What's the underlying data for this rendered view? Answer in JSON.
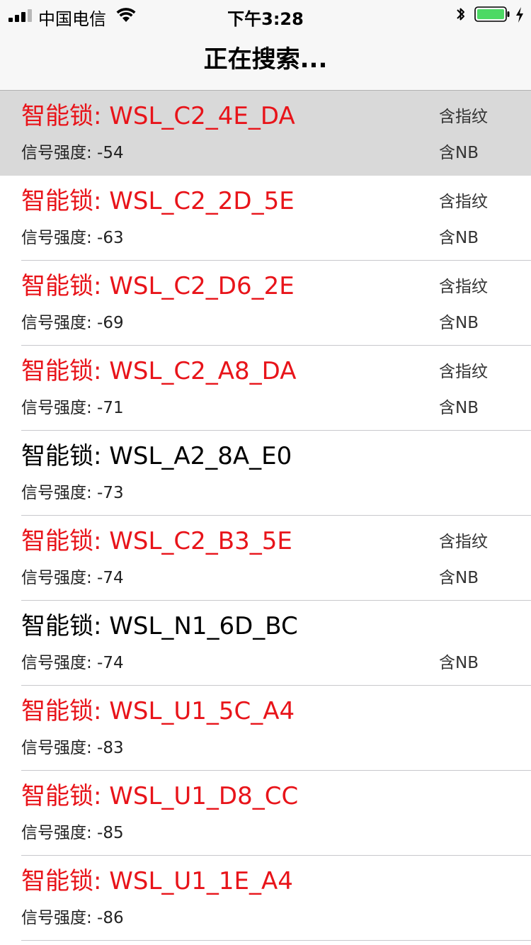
{
  "status_bar": {
    "carrier": "中国电信",
    "time": "下午3:28",
    "battery_color": "#4cd964"
  },
  "nav": {
    "title": "正在搜索..."
  },
  "colors": {
    "highlight_name": "#e8141a",
    "normal_name": "#000000",
    "selected_row_bg": "#d9d9d9"
  },
  "devices": [
    {
      "name": "智能锁: WSL_C2_4E_DA",
      "signal": "信号强度: -54",
      "fingerprint": "含指纹",
      "nb": "含NB",
      "highlight": true,
      "selected": true
    },
    {
      "name": "智能锁: WSL_C2_2D_5E",
      "signal": "信号强度: -63",
      "fingerprint": "含指纹",
      "nb": "含NB",
      "highlight": true,
      "selected": false
    },
    {
      "name": "智能锁: WSL_C2_D6_2E",
      "signal": "信号强度: -69",
      "fingerprint": "含指纹",
      "nb": "含NB",
      "highlight": true,
      "selected": false
    },
    {
      "name": "智能锁: WSL_C2_A8_DA",
      "signal": "信号强度: -71",
      "fingerprint": "含指纹",
      "nb": "含NB",
      "highlight": true,
      "selected": false
    },
    {
      "name": "智能锁: WSL_A2_8A_E0",
      "signal": "信号强度: -73",
      "fingerprint": "",
      "nb": "",
      "highlight": false,
      "selected": false
    },
    {
      "name": "智能锁: WSL_C2_B3_5E",
      "signal": "信号强度: -74",
      "fingerprint": "含指纹",
      "nb": "含NB",
      "highlight": true,
      "selected": false
    },
    {
      "name": "智能锁: WSL_N1_6D_BC",
      "signal": "信号强度: -74",
      "fingerprint": "",
      "nb": "含NB",
      "highlight": false,
      "selected": false
    },
    {
      "name": "智能锁: WSL_U1_5C_A4",
      "signal": "信号强度: -83",
      "fingerprint": "",
      "nb": "",
      "highlight": true,
      "selected": false
    },
    {
      "name": "智能锁: WSL_U1_D8_CC",
      "signal": "信号强度: -85",
      "fingerprint": "",
      "nb": "",
      "highlight": true,
      "selected": false
    },
    {
      "name": "智能锁: WSL_U1_1E_A4",
      "signal": "信号强度: -86",
      "fingerprint": "",
      "nb": "",
      "highlight": true,
      "selected": false
    }
  ]
}
